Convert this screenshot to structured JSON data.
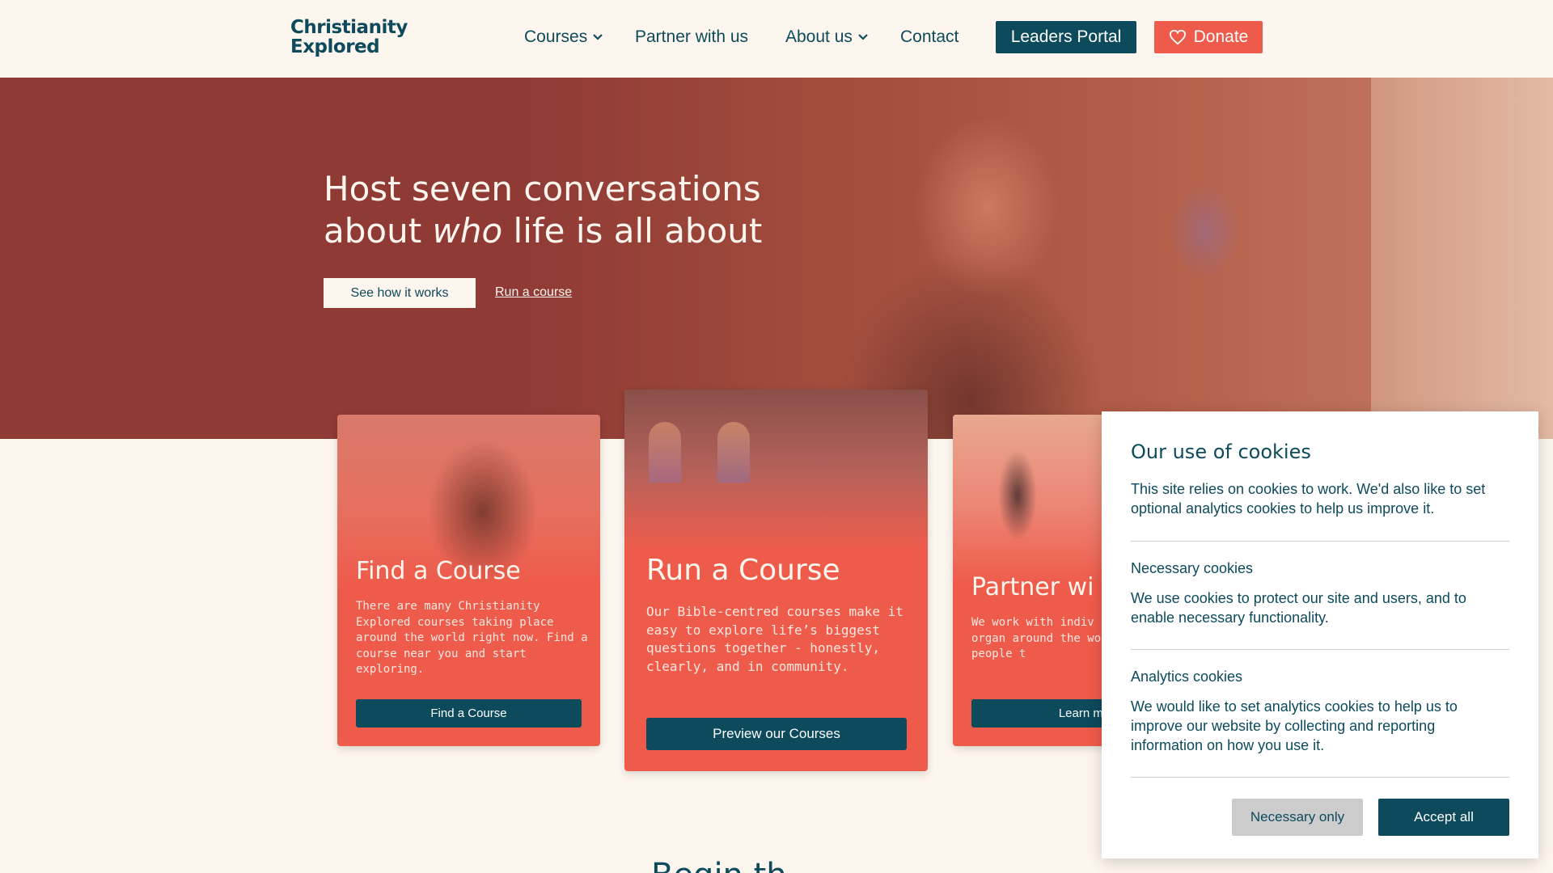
{
  "header": {
    "logo_line1": "Christianity",
    "logo_line2": "Explored",
    "nav": {
      "courses": "Courses",
      "partner": "Partner with us",
      "about": "About us",
      "contact": "Contact"
    },
    "leaders_portal": "Leaders Portal",
    "donate": "Donate"
  },
  "hero": {
    "title_line1": "Host seven conversations",
    "title_line2_pre": "about ",
    "title_line2_em": "who",
    "title_line2_post": " life is all about",
    "primary_button": "See how it works",
    "secondary_link": "Run a course"
  },
  "cards": [
    {
      "title": "Find a Course",
      "body": "There are many Christianity Explored courses taking place around the world right now. Find a course near you and start exploring.",
      "button": "Find a Course"
    },
    {
      "title": "Run a Course",
      "body": "Our Bible-centred courses make it easy to explore life’s biggest questions together - honestly, clearly, and in community.",
      "button": "Preview our Courses"
    },
    {
      "title": "Partner wi",
      "body": "We work with indiv churches and organ around the world t introduce people t",
      "button": "Learn mo"
    }
  ],
  "partial_heading": "Begin th",
  "cookies": {
    "title": "Our use of cookies",
    "intro": "This site relies on cookies to work. We'd also like to set optional analytics cookies to help us improve it.",
    "necessary_title": "Necessary cookies",
    "necessary_text": "We use cookies to protect our site and users, and to enable necessary functionality.",
    "analytics_title": "Analytics cookies",
    "analytics_text": "We would like to set analytics cookies to help us to improve our website by collecting and reporting information on how you use it.",
    "necessary_only": "Necessary only",
    "accept_all": "Accept all"
  },
  "colors": {
    "brand_dark": "#0c4a5c",
    "brand_coral": "#ef5b4b",
    "hero_bg": "#8f3a35",
    "page_bg": "#fdf6ee"
  }
}
